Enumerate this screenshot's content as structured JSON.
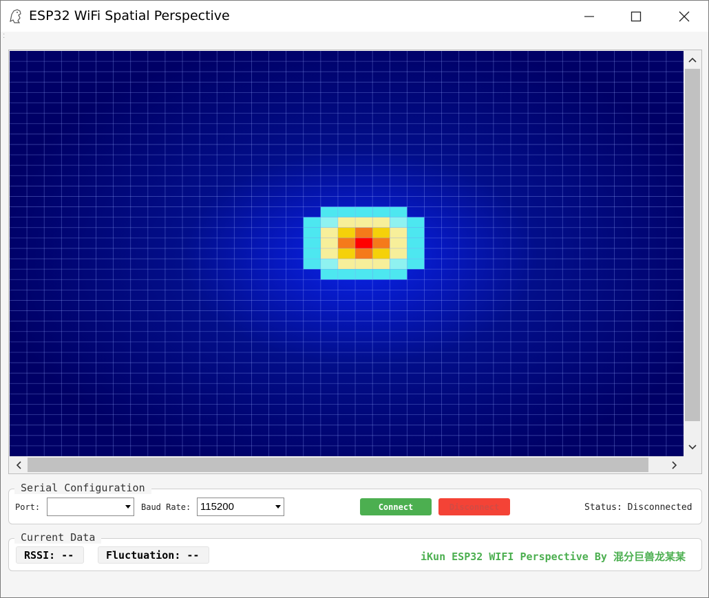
{
  "window": {
    "title": "ESP32 WiFi Spatial Perspective",
    "controls": {
      "minimize": "minimize",
      "maximize": "maximize",
      "close": "close"
    }
  },
  "heatmap": {
    "grid_columns": 39,
    "grid_rows": 39,
    "background_color": "#000066",
    "hotspot_colors": [
      "#ff0000",
      "#f57a1a",
      "#f5d10a",
      "#f7ef9a",
      "#8ff2f0",
      "#4de7f0"
    ]
  },
  "serial": {
    "group_title": "Serial Configuration",
    "port_label": "Port:",
    "port_value": "",
    "baud_label": "Baud Rate:",
    "baud_value": "115200",
    "connect_label": "Connect",
    "disconnect_label": "Disconnect",
    "status_text": "Status: Disconnected"
  },
  "current": {
    "group_title": "Current Data",
    "rssi_text": "RSSI: --",
    "fluctuation_text": "Fluctuation: --",
    "credit_text": "iKun ESP32 WIFI Perspective By 混分巨兽龙某某"
  },
  "colors": {
    "connect": "#4caf50",
    "disconnect": "#f44336",
    "credit": "#4caf50"
  }
}
